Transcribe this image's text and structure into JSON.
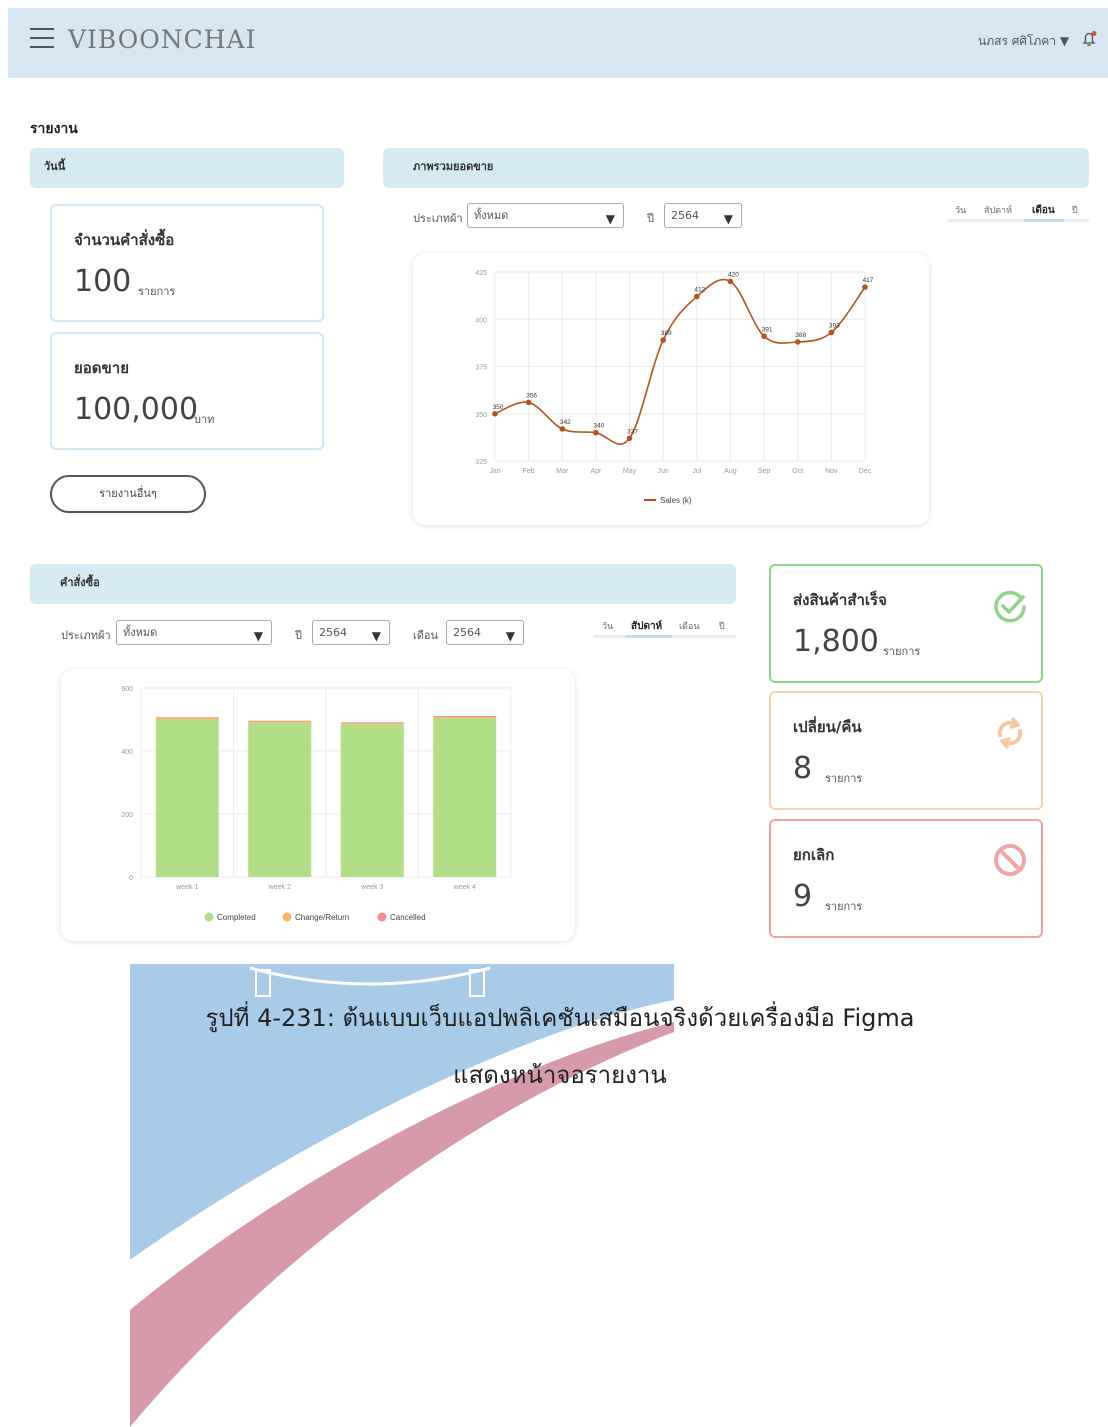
{
  "header": {
    "brand": "VIBOONCHAI",
    "user": "นภสร ศศิโภคา ▼"
  },
  "page_title": "รายงาน",
  "today_panel": {
    "title": "วันนี้"
  },
  "orders_card": {
    "label": "จำนวนคำสั่งซื้อ",
    "value": "100",
    "unit": "รายการ"
  },
  "sales_card": {
    "label": "ยอดขาย",
    "value": "100,000",
    "unit": "บาท"
  },
  "other_reports_button": "รายงานอื่นๆ",
  "sales_overview": {
    "title": "ภาพรวมยอดขาย",
    "filter_category_label": "ประเภทผ้า",
    "filter_category_value": "ทั้งหมด",
    "filter_year_label": "ปี",
    "filter_year_value": "2564",
    "periods": [
      "วัน",
      "สัปดาห์",
      "เดือน",
      "ปี"
    ],
    "active_period": "เดือน"
  },
  "orders_panel": {
    "title": "คำสั่งซื้อ",
    "filter_category_label": "ประเภทผ้า",
    "filter_category_value": "ทั้งหมด",
    "filter_year_label": "ปี",
    "filter_year_value": "2564",
    "filter_month_label": "เดือน",
    "filter_month_value": "2564",
    "periods": [
      "วัน",
      "สัปดาห์",
      "เดือน",
      "ปี"
    ],
    "active_period": "สัปดาห์"
  },
  "status_cards": [
    {
      "label": "ส่งสินค้าสำเร็จ",
      "value": "1,800",
      "unit": "รายการ",
      "color": "#8fd48b",
      "icon": "check-circle-icon"
    },
    {
      "label": "เปลี่ยน/คืน",
      "value": "8",
      "unit": "รายการ",
      "color": "#f5c9a0",
      "icon": "refresh-icon"
    },
    {
      "label": "ยกเลิก",
      "value": "9",
      "unit": "รายการ",
      "color": "#f0a4a4",
      "icon": "ban-icon"
    }
  ],
  "caption": {
    "line1": "รูปที่ 4-231: ต้นแบบเว็บแอปพลิเคชันเสมือนจริงด้วยเครื่องมือ Figma",
    "line2": "แสดงหน้าจอรายงาน"
  },
  "chart_data": [
    {
      "type": "line",
      "categories": [
        "Jan",
        "Feb",
        "Mar",
        "Apr",
        "May",
        "Jun",
        "Jul",
        "Aug",
        "Sep",
        "Oct",
        "Nov",
        "Dec"
      ],
      "series": [
        {
          "name": "Sales (k)",
          "values": [
            350,
            356,
            342,
            340,
            337,
            389,
            412,
            420,
            391,
            388,
            393,
            417
          ],
          "color": "#b5541d"
        }
      ],
      "ylim": [
        325,
        425
      ],
      "yticks": [
        325,
        350,
        375,
        400,
        425
      ],
      "grid": true,
      "legend": "bottom"
    },
    {
      "type": "bar",
      "stacked": true,
      "categories": [
        "week 1",
        "week 2",
        "week 3",
        "week 4"
      ],
      "series": [
        {
          "name": "Completed",
          "values": [
            500,
            490,
            485,
            505
          ],
          "color": "#b1de86"
        },
        {
          "name": "Change/Return",
          "values": [
            4,
            3,
            3,
            3
          ],
          "color": "#f7b657"
        },
        {
          "name": "Cancelled",
          "values": [
            3,
            3,
            3,
            3
          ],
          "color": "#f28d8d"
        }
      ],
      "ylim": [
        0,
        600
      ],
      "yticks": [
        0,
        200,
        400,
        600
      ],
      "grid": true,
      "legend": "bottom"
    }
  ]
}
